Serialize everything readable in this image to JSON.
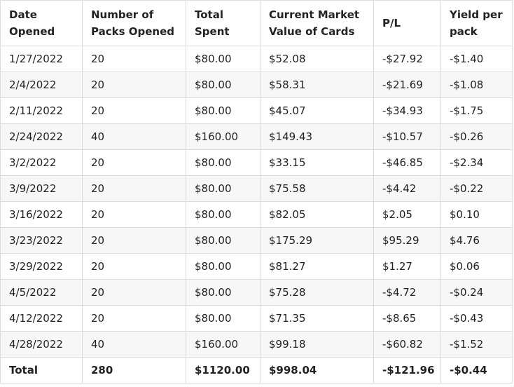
{
  "headers": [
    "Date Opened",
    "Number of Packs Opened",
    "Total Spent",
    "Current Market Value of Cards",
    "P/L",
    "Yield per pack"
  ],
  "rows": [
    [
      "1/27/2022",
      "20",
      "$80.00",
      "$52.08",
      "-$27.92",
      "-$1.40"
    ],
    [
      "2/4/2022",
      "20",
      "$80.00",
      "$58.31",
      "-$21.69",
      "-$1.08"
    ],
    [
      "2/11/2022",
      "20",
      "$80.00",
      "$45.07",
      "-$34.93",
      "-$1.75"
    ],
    [
      "2/24/2022",
      "40",
      "$160.00",
      "$149.43",
      "-$10.57",
      "-$0.26"
    ],
    [
      "3/2/2022",
      "20",
      "$80.00",
      "$33.15",
      "-$46.85",
      "-$2.34"
    ],
    [
      "3/9/2022",
      "20",
      "$80.00",
      "$75.58",
      "-$4.42",
      "-$0.22"
    ],
    [
      "3/16/2022",
      "20",
      "$80.00",
      "$82.05",
      "$2.05",
      "$0.10"
    ],
    [
      "3/23/2022",
      "20",
      "$80.00",
      "$175.29",
      "$95.29",
      "$4.76"
    ],
    [
      "3/29/2022",
      "20",
      "$80.00",
      "$81.27",
      "$1.27",
      "$0.06"
    ],
    [
      "4/5/2022",
      "20",
      "$80.00",
      "$75.28",
      "-$4.72",
      "-$0.24"
    ],
    [
      "4/12/2022",
      "20",
      "$80.00",
      "$71.35",
      "-$8.65",
      "-$0.43"
    ],
    [
      "4/28/2022",
      "40",
      "$160.00",
      "$99.18",
      "-$60.82",
      "-$1.52"
    ]
  ],
  "total": [
    "Total",
    "280",
    "$1120.00",
    "$998.04",
    "-$121.96",
    "-$0.44"
  ]
}
